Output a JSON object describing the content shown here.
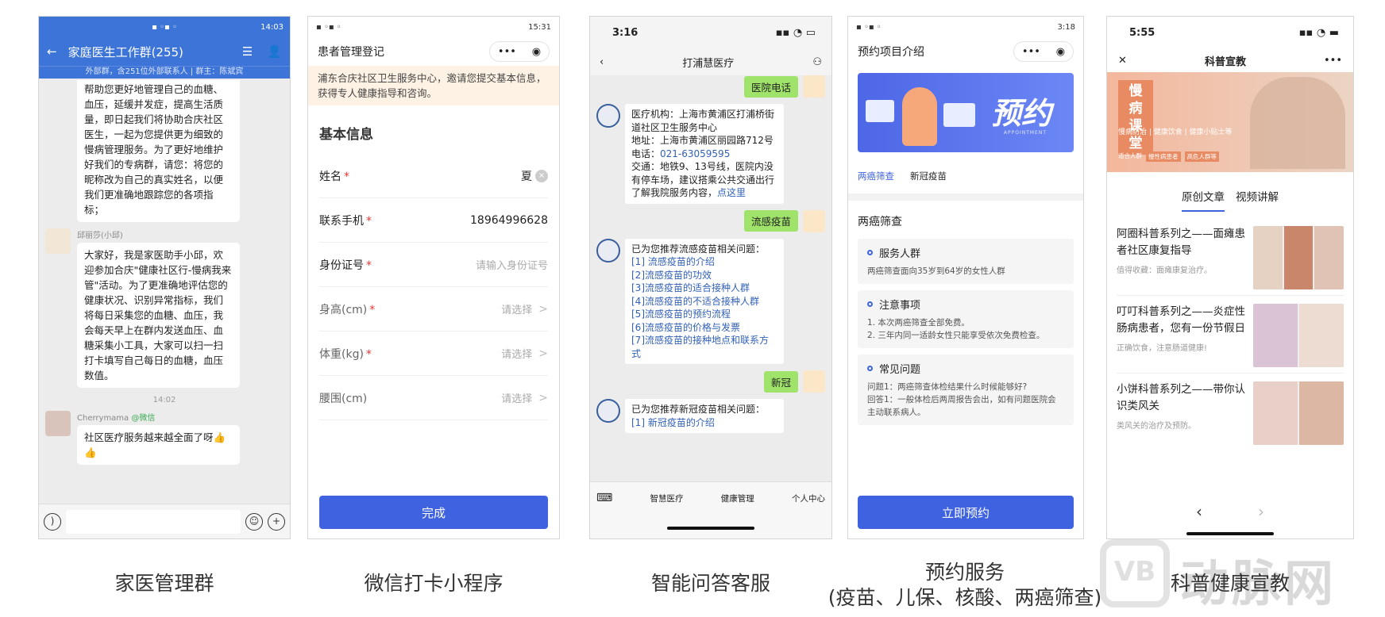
{
  "phone1": {
    "status_time": "14:03",
    "title": "家庭医生工作群(255)",
    "subtitle": "外部群，含251位外部联系人 | 群主：陈斌宾",
    "msg1": "帮助您更好地管理自己的血糖、血压，延缓并发症，提高生活质量，即日起我们将协助合庆社区医生，一起为您提供更为细致的慢病管理服务。为了更好地维护好我们的专病群，请您：将您的昵称改为自己的真实姓名，以便我们更准确地跟踪您的各项指标；",
    "msg2_sender": "邱丽莎(小邱)",
    "msg2": "大家好，我是家医助手小邱，欢迎参加合庆\"健康社区行-慢病我来管\"活动。为了更准确地评估您的健康状况、识别异常指标，我们将每日采集您的血糖、血压，我会每天早上在群内发送血压、血糖采集小工具，大家可以扫一扫打卡填写自己每日的血糖，血压数值。",
    "time_divider": "14:02",
    "msg3_sender": "Cherrymama",
    "msg3_sender_tag": "@微信",
    "msg3": "社区医疗服务越来越全面了呀👍👍"
  },
  "phone2": {
    "status_time": "15:31",
    "title": "患者管理登记",
    "notice": "浦东合庆社区卫生服务中心，邀请您提交基本信息，获得专人健康指导和咨询。",
    "section": "基本信息",
    "rows": [
      {
        "label": "姓名",
        "value": "夏"
      },
      {
        "label": "联系手机",
        "value": "18964996628"
      },
      {
        "label": "身份证号",
        "placeholder": "请输入身份证号"
      },
      {
        "label": "身高(cm)",
        "placeholder": "请选择"
      },
      {
        "label": "体重(kg)",
        "placeholder": "请选择"
      },
      {
        "label": "腰围(cm)",
        "placeholder": "请选择"
      }
    ],
    "submit": "完成"
  },
  "phone3": {
    "status_time": "3:16",
    "title": "打浦慧医疗",
    "user1": "医院电话",
    "bot1_lines": [
      "医疗机构：上海市黄浦区打浦桥街道社区卫生服务中心",
      "地址：上海市黄浦区丽园路712号"
    ],
    "bot1_phone_label": "电话：",
    "bot1_phone": "021-63059595",
    "bot1_traffic": "交通：地铁9、13号线，医院内没有停车场，建议搭乘公共交通出行",
    "bot1_more": "了解我院服务内容，",
    "bot1_link": "点这里",
    "user2": "流感疫苗",
    "bot2_intro": "已为您推荐流感疫苗相关问题：",
    "bot2_links": [
      "[1] 流感疫苗的介绍",
      "[2]流感疫苗的功效",
      "[3]流感疫苗的适合接种人群",
      "[4]流感疫苗的不适合接种人群",
      "[5]流感疫苗的预约流程",
      "[6]流感疫苗的价格与发票",
      "[7]流感疫苗的接种地点和联系方式"
    ],
    "user3": "新冠",
    "bot3_intro": "已为您推荐新冠疫苗相关问题：",
    "bot3_partial": "[1] 新冠疫苗的介绍",
    "tabs": [
      "智慧医疗",
      "健康管理",
      "个人中心"
    ]
  },
  "phone4": {
    "status_time": "3:18",
    "title": "预约项目介绍",
    "banner_text": "预约",
    "banner_small": "APPOINTMENT",
    "tabs": [
      "两癌筛查",
      "新冠疫苗"
    ],
    "section": "两癌筛查",
    "cards": [
      {
        "title": "服务人群",
        "desc": "两癌筛查面向35岁到64岁的女性人群"
      },
      {
        "title": "注意事项",
        "desc": "1. 本次两癌筛查全部免费。\n2. 三年内同一适龄女性只能享受依次免费检查。"
      },
      {
        "title": "常见问题",
        "desc": "问题1：两癌筛查体检结果什么时候能够好?\n回答1：一般体检后两周报告会出，如有问题医院会主动联系病人。"
      }
    ],
    "button": "立即预约"
  },
  "phone5": {
    "status_time": "5:55",
    "title": "科普宣教",
    "hero_title": "慢病课堂",
    "hero_subtitle": "慢病防治 | 健康饮食 | 健康小贴士等",
    "hero_tag_label": "适合人群",
    "hero_tags": [
      "慢性病患者",
      "高危人群等"
    ],
    "tabs": [
      "原创文章",
      "视频讲解"
    ],
    "articles": [
      {
        "title": "阿圈科普系列之——面瘫患者社区康复指导",
        "desc": "值得收藏：面瘫康复治疗。"
      },
      {
        "title": "叮叮科普系列之——炎症性肠病患者，您有一份节假日",
        "desc": "正确饮食，注意肠道健康!"
      },
      {
        "title": "小饼科普系列之——带你认识类风关",
        "desc": "类风关的治疗及预防。"
      }
    ]
  },
  "captions": [
    "家医管理群",
    "微信打卡小程序",
    "智能问答客服",
    "预约服务",
    "(疫苗、儿保、核酸、两癌筛查)",
    "科普健康宣教"
  ],
  "watermark": "动脉网"
}
